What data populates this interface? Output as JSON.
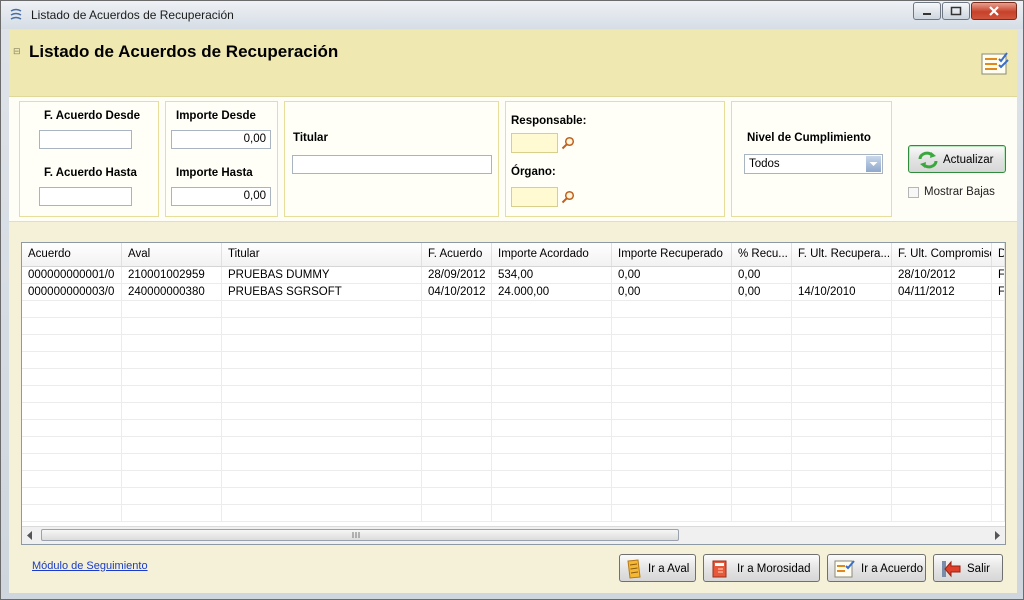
{
  "window": {
    "title": "Listado de Acuerdos de Recuperación"
  },
  "header": {
    "title": "Listado de Acuerdos de Recuperación"
  },
  "filters": {
    "f_acuerdo_desde": {
      "label": "F. Acuerdo Desde",
      "value": ""
    },
    "f_acuerdo_hasta": {
      "label": "F. Acuerdo Hasta",
      "value": ""
    },
    "importe_desde": {
      "label": "Importe Desde",
      "value": "0,00"
    },
    "importe_hasta": {
      "label": "Importe Hasta",
      "value": "0,00"
    },
    "titular": {
      "label": "Titular",
      "value": ""
    },
    "responsable": {
      "label": "Responsable:"
    },
    "organo": {
      "label": "Órgano:"
    },
    "nivel": {
      "label": "Nivel de Cumplimiento",
      "selected": "Todos"
    },
    "actualizar_label": "Actualizar",
    "mostrar_bajas_label": "Mostrar Bajas"
  },
  "grid": {
    "columns": [
      "Acuerdo",
      "Aval",
      "Titular",
      "F. Acuerdo",
      "Importe Acordado",
      "Importe Recuperado",
      "% Recu...",
      "F. Ult. Recupera...",
      "F. Ult. Compromiso",
      "D"
    ],
    "rows": [
      [
        "000000000001/0",
        "210001002959",
        "PRUEBAS DUMMY",
        "28/09/2012",
        "534,00",
        "0,00",
        "0,00",
        "",
        "28/10/2012",
        "F"
      ],
      [
        "000000000003/0",
        "240000000380",
        "PRUEBAS SGRSOFT",
        "04/10/2012",
        "24.000,00",
        "0,00",
        "0,00",
        "14/10/2010",
        "04/11/2012",
        "F"
      ]
    ]
  },
  "footer": {
    "link": "Módulo de Seguimiento",
    "buttons": {
      "ir_aval": "Ir a Aval",
      "ir_morosidad": "Ir a Morosidad",
      "ir_acuerdo": "Ir a Acuerdo",
      "salir": "Salir"
    }
  },
  "colors": {
    "header_bg": "#efe8b0",
    "client_bg": "#f4f1d8",
    "refresh_border": "#2f8c3c",
    "link": "#1a3cc8"
  }
}
